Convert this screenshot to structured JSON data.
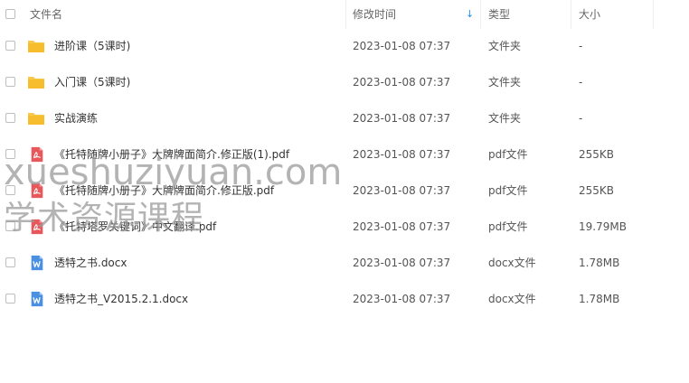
{
  "header": {
    "name_label": "文件名",
    "modified_label": "修改时间",
    "type_label": "类型",
    "size_label": "大小",
    "sort_indicator": "↓"
  },
  "files": [
    {
      "name": "进阶课（5课时)",
      "date": "2023-01-08 07:37",
      "type": "文件夹",
      "size": "-",
      "icon": "folder-icon"
    },
    {
      "name": "入门课（5课时)",
      "date": "2023-01-08 07:37",
      "type": "文件夹",
      "size": "-",
      "icon": "folder-icon"
    },
    {
      "name": "实战演练",
      "date": "2023-01-08 07:37",
      "type": "文件夹",
      "size": "-",
      "icon": "folder-icon"
    },
    {
      "name": "《托特随牌小册子》大牌牌面简介.修正版(1).pdf",
      "date": "2023-01-08 07:37",
      "type": "pdf文件",
      "size": "255KB",
      "icon": "pdf-icon"
    },
    {
      "name": "《托特随牌小册子》大牌牌面简介.修正版.pdf",
      "date": "2023-01-08 07:37",
      "type": "pdf文件",
      "size": "255KB",
      "icon": "pdf-icon"
    },
    {
      "name": "《托特塔罗关键词》中文翻译.pdf",
      "date": "2023-01-08 07:37",
      "type": "pdf文件",
      "size": "19.79MB",
      "icon": "pdf-icon"
    },
    {
      "name": "透特之书.docx",
      "date": "2023-01-08 07:37",
      "type": "docx文件",
      "size": "1.78MB",
      "icon": "word-doc-icon"
    },
    {
      "name": "透特之书_V2015.2.1.docx",
      "date": "2023-01-08 07:37",
      "type": "docx文件",
      "size": "1.78MB",
      "icon": "word-doc-icon"
    }
  ],
  "watermark": {
    "line1": "xueshuziyuan.com",
    "line2": "学术资源课程"
  },
  "colors": {
    "folder": "#f9c846",
    "pdf": "#e8585a",
    "word": "#4a90e2",
    "sort_accent": "#2d8cf0"
  }
}
